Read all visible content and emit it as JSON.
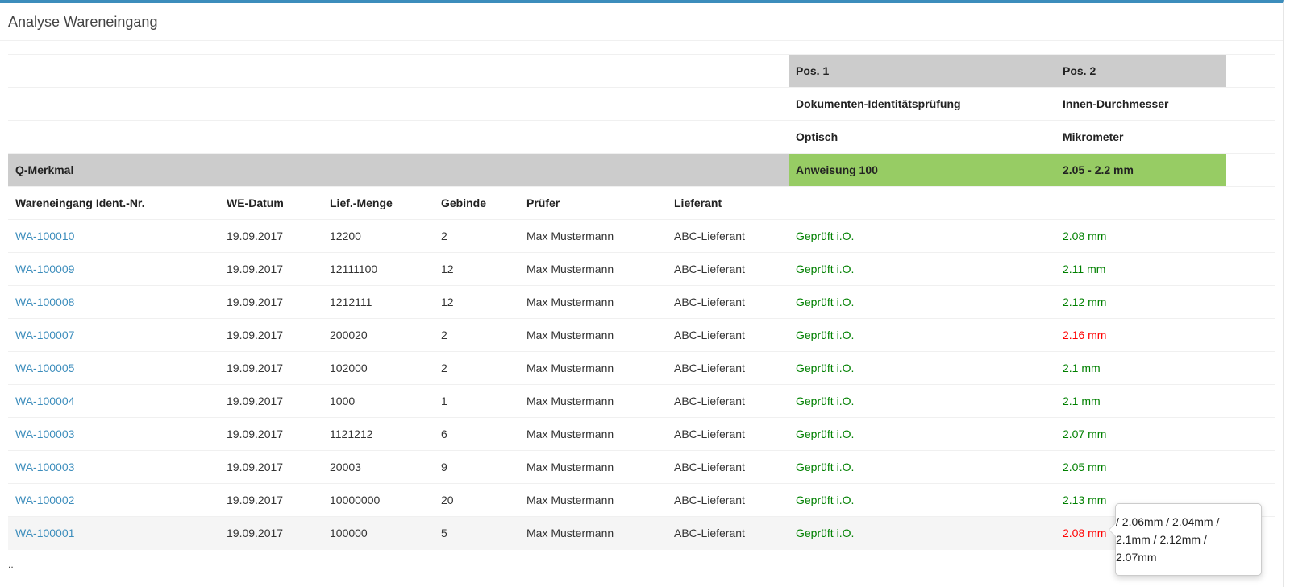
{
  "panel": {
    "title": "Analyse Wareneingang"
  },
  "header_rows": {
    "pos": [
      "Pos. 1",
      "Pos. 2"
    ],
    "check_name": [
      "Dokumenten-Identitätsprüfung",
      "Innen-Durchmesser"
    ],
    "method": [
      "Optisch",
      "Mikrometer"
    ],
    "q_label": "Q-Merkmal",
    "spec": [
      "Anweisung 100",
      "2.05 - 2.2 mm"
    ]
  },
  "columns": {
    "ident": "Wareneingang Ident.-Nr.",
    "date": "WE-Datum",
    "qty": "Lief.-Menge",
    "containers": "Gebinde",
    "inspector": "Prüfer",
    "supplier": "Lieferant"
  },
  "rows": [
    {
      "ident": "WA-100010",
      "date": "19.09.2017",
      "qty": "12200",
      "containers": "2",
      "inspector": "Max Mustermann",
      "supplier": "ABC-Lieferant",
      "pos1": "Geprüft i.O.",
      "pos2": "2.08 mm",
      "pos2_status": "ok"
    },
    {
      "ident": "WA-100009",
      "date": "19.09.2017",
      "qty": "12111100",
      "containers": "12",
      "inspector": "Max Mustermann",
      "supplier": "ABC-Lieferant",
      "pos1": "Geprüft i.O.",
      "pos2": "2.11 mm",
      "pos2_status": "ok"
    },
    {
      "ident": "WA-100008",
      "date": "19.09.2017",
      "qty": "1212111",
      "containers": "12",
      "inspector": "Max Mustermann",
      "supplier": "ABC-Lieferant",
      "pos1": "Geprüft i.O.",
      "pos2": "2.12 mm",
      "pos2_status": "ok"
    },
    {
      "ident": "WA-100007",
      "date": "19.09.2017",
      "qty": "200020",
      "containers": "2",
      "inspector": "Max Mustermann",
      "supplier": "ABC-Lieferant",
      "pos1": "Geprüft i.O.",
      "pos2": "2.16 mm",
      "pos2_status": "bad"
    },
    {
      "ident": "WA-100005",
      "date": "19.09.2017",
      "qty": "102000",
      "containers": "2",
      "inspector": "Max Mustermann",
      "supplier": "ABC-Lieferant",
      "pos1": "Geprüft i.O.",
      "pos2": "2.1 mm",
      "pos2_status": "ok"
    },
    {
      "ident": "WA-100004",
      "date": "19.09.2017",
      "qty": "1000",
      "containers": "1",
      "inspector": "Max Mustermann",
      "supplier": "ABC-Lieferant",
      "pos1": "Geprüft i.O.",
      "pos2": "2.1 mm",
      "pos2_status": "ok"
    },
    {
      "ident": "WA-100003",
      "date": "19.09.2017",
      "qty": "1121212",
      "containers": "6",
      "inspector": "Max Mustermann",
      "supplier": "ABC-Lieferant",
      "pos1": "Geprüft i.O.",
      "pos2": "2.07 mm",
      "pos2_status": "ok"
    },
    {
      "ident": "WA-100003",
      "date": "19.09.2017",
      "qty": "20003",
      "containers": "9",
      "inspector": "Max Mustermann",
      "supplier": "ABC-Lieferant",
      "pos1": "Geprüft i.O.",
      "pos2": "2.05 mm",
      "pos2_status": "ok"
    },
    {
      "ident": "WA-100002",
      "date": "19.09.2017",
      "qty": "10000000",
      "containers": "20",
      "inspector": "Max Mustermann",
      "supplier": "ABC-Lieferant",
      "pos1": "Geprüft i.O.",
      "pos2": "2.13 mm",
      "pos2_status": "ok"
    },
    {
      "ident": "WA-100001",
      "date": "19.09.2017",
      "qty": "100000",
      "containers": "5",
      "inspector": "Max Mustermann",
      "supplier": "ABC-Lieferant",
      "pos1": "Geprüft i.O.",
      "pos2": "2.08 mm",
      "pos2_status": "bad"
    }
  ],
  "hovered_row": 9,
  "tooltip": {
    "lines": [
      "/ 2.06mm / 2.04mm /",
      "2.1mm / 2.12mm /",
      "2.07mm"
    ]
  },
  "footer": {
    "text": ".."
  },
  "colors": {
    "accent": "#3c8dbc",
    "header_gray": "#cccccc",
    "spec_green": "#97cc64",
    "ok_text": "#008000",
    "bad_text": "#ff0000"
  }
}
